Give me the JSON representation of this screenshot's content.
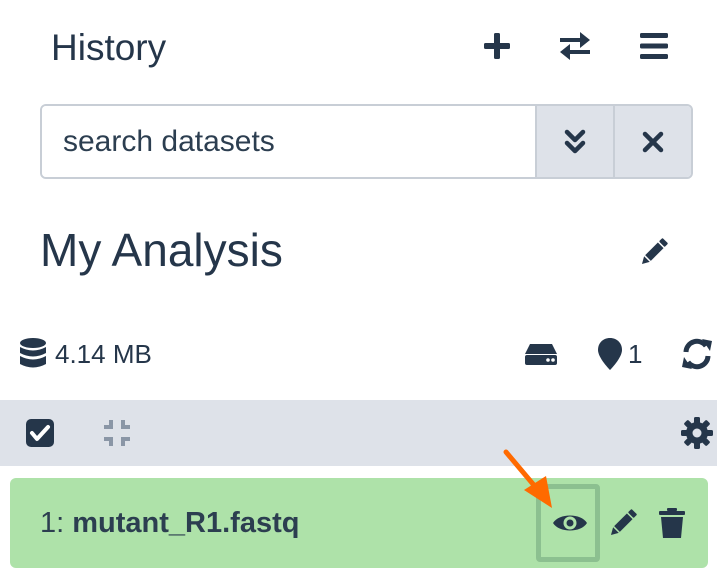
{
  "header": {
    "title": "History",
    "icons": {
      "new": "plus-icon",
      "switch": "exchange-arrows-icon",
      "menu": "bars-menu-icon"
    }
  },
  "search": {
    "placeholder": "search datasets",
    "value": "",
    "icons": {
      "advanced": "double-chevron-down-icon",
      "clear": "close-x-icon"
    }
  },
  "history": {
    "name": "My Analysis",
    "edit_icon": "pencil-icon"
  },
  "stats": {
    "size": "4.14 MB",
    "size_icon": "database-icon",
    "storage_icon": "hard-drive-icon",
    "marker_icon": "map-marker-icon",
    "marker_count": "1",
    "refresh_icon": "sync-arrows-icon"
  },
  "toolbar": {
    "select_icon": "checkbox-checked-icon",
    "collapse_icon": "compress-icon",
    "settings_icon": "gear-icon"
  },
  "datasets": [
    {
      "hid": "1:",
      "name": "mutant_R1.fastq",
      "state_color": "#aee2a9",
      "actions": [
        "eye-icon",
        "pencil-icon",
        "trash-icon"
      ]
    }
  ],
  "annotation": {
    "arrow_color": "#ff6a00",
    "highlight_color": "#8cc090"
  },
  "colors": {
    "text": "#25364a",
    "toolbar_bg": "#dee2e9",
    "search_border": "#c8ced6"
  }
}
